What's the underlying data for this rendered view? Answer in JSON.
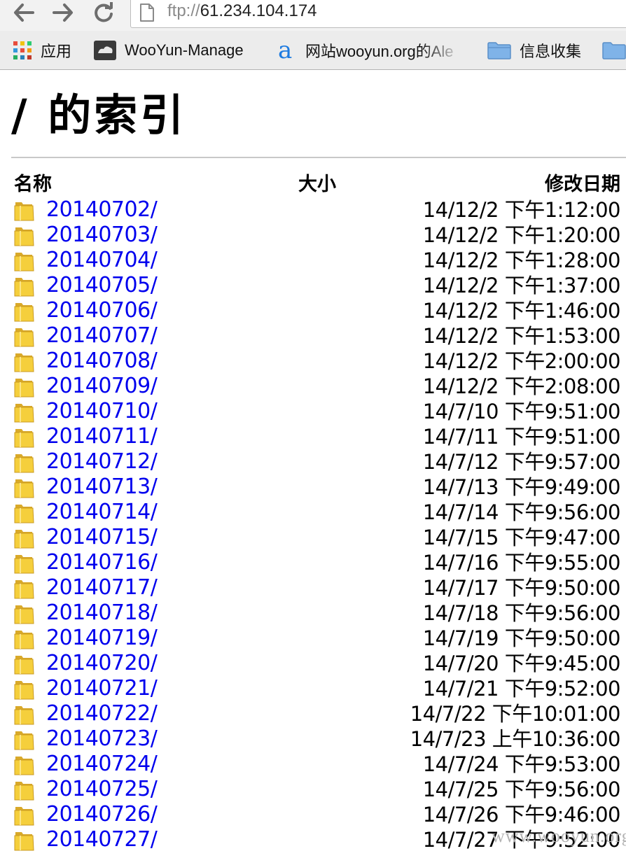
{
  "browser": {
    "url_scheme": "ftp://",
    "url_host": "61.234.104.174",
    "bookmarks": [
      {
        "label": "应用",
        "icon": "apps-grid-icon"
      },
      {
        "label": "WooYun-Manage",
        "icon": "wooyun-logo-icon"
      },
      {
        "label": "网站wooyun.org的Ale",
        "icon": "alexa-a-icon"
      },
      {
        "label": "信息收集",
        "icon": "folder-icon"
      }
    ]
  },
  "page": {
    "title": "/ 的索引",
    "columns": {
      "name": "名称",
      "size": "大小",
      "modified": "修改日期"
    },
    "entries": [
      {
        "name": "20140702/",
        "date": "14/12/2 下午1:12:00"
      },
      {
        "name": "20140703/",
        "date": "14/12/2 下午1:20:00"
      },
      {
        "name": "20140704/",
        "date": "14/12/2 下午1:28:00"
      },
      {
        "name": "20140705/",
        "date": "14/12/2 下午1:37:00"
      },
      {
        "name": "20140706/",
        "date": "14/12/2 下午1:46:00"
      },
      {
        "name": "20140707/",
        "date": "14/12/2 下午1:53:00"
      },
      {
        "name": "20140708/",
        "date": "14/12/2 下午2:00:00"
      },
      {
        "name": "20140709/",
        "date": "14/12/2 下午2:08:00"
      },
      {
        "name": "20140710/",
        "date": "14/7/10 下午9:51:00"
      },
      {
        "name": "20140711/",
        "date": "14/7/11 下午9:51:00"
      },
      {
        "name": "20140712/",
        "date": "14/7/12 下午9:57:00"
      },
      {
        "name": "20140713/",
        "date": "14/7/13 下午9:49:00"
      },
      {
        "name": "20140714/",
        "date": "14/7/14 下午9:56:00"
      },
      {
        "name": "20140715/",
        "date": "14/7/15 下午9:47:00"
      },
      {
        "name": "20140716/",
        "date": "14/7/16 下午9:55:00"
      },
      {
        "name": "20140717/",
        "date": "14/7/17 下午9:50:00"
      },
      {
        "name": "20140718/",
        "date": "14/7/18 下午9:56:00"
      },
      {
        "name": "20140719/",
        "date": "14/7/19 下午9:50:00"
      },
      {
        "name": "20140720/",
        "date": "14/7/20 下午9:45:00"
      },
      {
        "name": "20140721/",
        "date": "14/7/21 下午9:52:00"
      },
      {
        "name": "20140722/",
        "date": "14/7/22 下午10:01:00"
      },
      {
        "name": "20140723/",
        "date": "14/7/23 上午10:36:00"
      },
      {
        "name": "20140724/",
        "date": "14/7/24 下午9:53:00"
      },
      {
        "name": "20140725/",
        "date": "14/7/25 下午9:56:00"
      },
      {
        "name": "20140726/",
        "date": "14/7/26 下午9:46:00"
      },
      {
        "name": "20140727/",
        "date": "14/7/27 下午9:52:00"
      }
    ]
  },
  "watermark": "www.wooyun.org",
  "colors": {
    "link": "#0000ee",
    "folder": "#f5cf3c",
    "folder_dark": "#d9a92a"
  }
}
